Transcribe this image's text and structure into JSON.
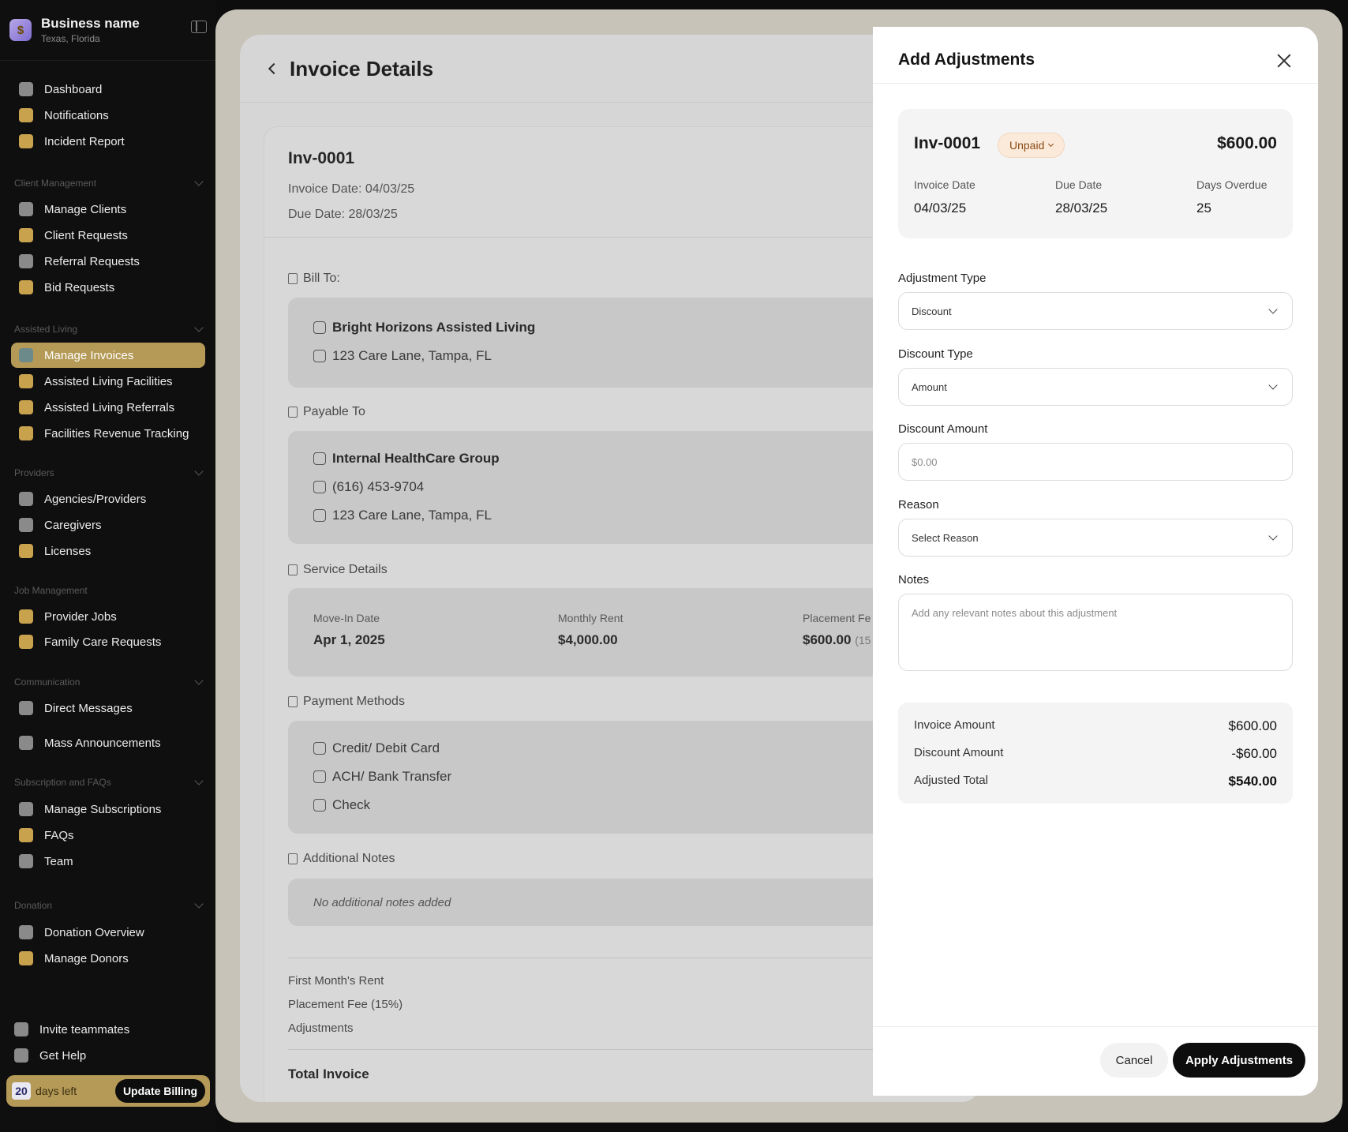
{
  "brand": {
    "name": "Business name",
    "location": "Texas, Florida",
    "logo_glyph": "$"
  },
  "sidebar": {
    "top_items": [
      {
        "label": "Dashboard",
        "icon": "home-icon"
      },
      {
        "label": "Notifications",
        "icon": "bell-icon"
      },
      {
        "label": "Incident Report",
        "icon": "clipboard-icon"
      }
    ],
    "sections": [
      {
        "title": "Client Management",
        "items": [
          "Manage Clients",
          "Client Requests",
          "Referral Requests",
          "Bid Requests"
        ]
      },
      {
        "title": "Assisted Living",
        "items": [
          "Manage Invoices",
          "Assisted Living Facilities",
          "Assisted Living Referrals",
          "Facilities Revenue Tracking"
        ]
      },
      {
        "title": "Providers",
        "items": [
          "Agencies/Providers",
          "Caregivers",
          "Licenses"
        ]
      },
      {
        "title": "Job Management",
        "items": [
          "Provider Jobs",
          "Family Care Requests"
        ]
      },
      {
        "title": "Communication",
        "items": [
          "Direct Messages",
          "Mass Announcements"
        ]
      },
      {
        "title": "Subscription and FAQs",
        "items": [
          "Manage Subscriptions",
          "FAQs",
          "Team"
        ]
      },
      {
        "title": "Donation",
        "items": [
          "Donation Overview",
          "Manage Donors"
        ]
      }
    ],
    "footer_items": [
      "Invite teammates",
      "Get Help"
    ],
    "billing": {
      "days": "20",
      "text": "days left",
      "button": "Update Billing"
    },
    "active_color": "#b59a57"
  },
  "invoice_page": {
    "title": "Invoice Details",
    "invoice_no": "Inv-0001",
    "invoice_date": "Invoice Date: 04/03/25",
    "due_date": "Due Date: 28/03/25",
    "bill_to": {
      "title": "Bill To:",
      "name": "Bright Horizons Assisted Living",
      "address": "123 Care Lane, Tampa, FL"
    },
    "payable_to": {
      "title": "Payable To",
      "name": "Internal HealthCare Group",
      "phone": "(616) 453-9704",
      "address": "123 Care Lane, Tampa, FL"
    },
    "service": {
      "title": "Service Details",
      "move_in_label": "Move-In Date",
      "move_in": "Apr 1, 2025",
      "rent_label": "Monthly Rent",
      "rent": "$4,000.00",
      "fee_label": "Placement Fe",
      "fee": "$600.00",
      "fee_note": "(15"
    },
    "payment": {
      "title": "Payment Methods",
      "methods": [
        "Credit/ Debit Card",
        "ACH/ Bank Transfer",
        "Check"
      ]
    },
    "notes": {
      "title": "Additional Notes",
      "text": "No additional notes added"
    },
    "summary": {
      "rent": "First Month's Rent",
      "fee": "Placement Fee (15%)",
      "adjustments": "Adjustments",
      "total": "Total Invoice"
    }
  },
  "modal": {
    "title": "Add Adjustments",
    "invoice_no": "Inv-0001",
    "status": "Unpaid",
    "amount": "$600.00",
    "invoice_date_label": "Invoice Date",
    "invoice_date": "04/03/25",
    "due_date_label": "Due Date",
    "due_date": "28/03/25",
    "days_overdue_label": "Days Overdue",
    "days_overdue": "25",
    "adjustment_type": {
      "label": "Adjustment Type",
      "value": "Discount"
    },
    "discount_type": {
      "label": "Discount Type",
      "value": "Amount"
    },
    "discount_amount": {
      "label": "Discount Amount",
      "placeholder": "$0.00"
    },
    "reason": {
      "label": "Reason",
      "value": "Select Reason"
    },
    "notes": {
      "label": "Notes",
      "placeholder": "Add any relevant notes about this adjustment"
    },
    "calc": {
      "invoice_amount_label": "Invoice Amount",
      "invoice_amount": "$600.00",
      "discount_amount_label": "Discount Amount",
      "discount_amount": "-$60.00",
      "adjusted_total_label": "Adjusted Total",
      "adjusted_total": "$540.00"
    },
    "cancel": "Cancel",
    "apply": "Apply Adjustments"
  }
}
